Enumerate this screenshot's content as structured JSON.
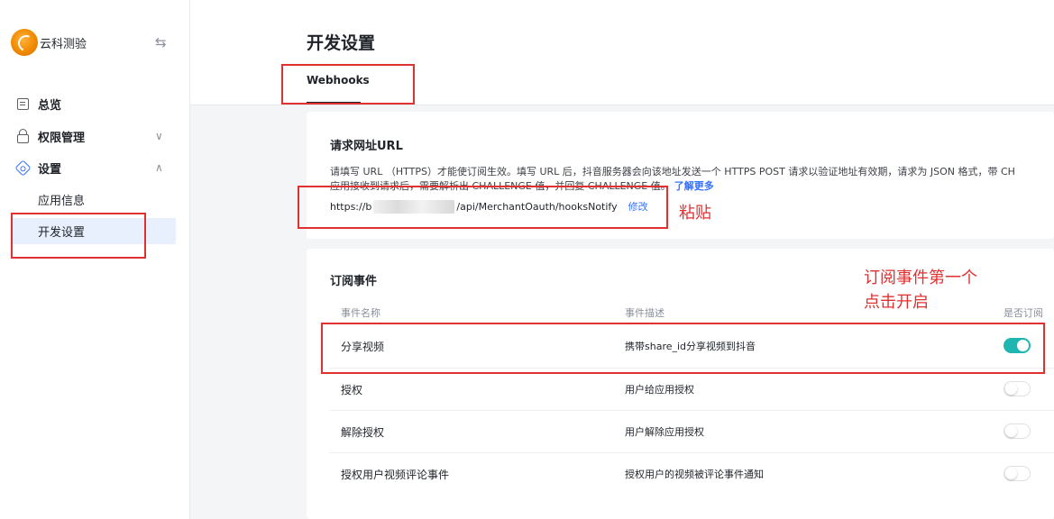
{
  "brand": {
    "name": "云科测验"
  },
  "sidebar": {
    "items": [
      {
        "label": "总览"
      },
      {
        "label": "权限管理"
      },
      {
        "label": "设置"
      }
    ],
    "sub_items": [
      {
        "label": "应用信息"
      },
      {
        "label": "开发设置"
      }
    ]
  },
  "page": {
    "title": "开发设置"
  },
  "tabs": [
    {
      "label": "Webhooks"
    }
  ],
  "request_url": {
    "title": "请求网址URL",
    "description_line1": "请填写 URL （HTTPS）才能使订阅生效。填写 URL 后，抖音服务器会向该地址发送一个 HTTPS POST 请求以验证地址有效期，请求为 JSON 格式，带 CH",
    "description_line2": "应用接收到请求后，需要解析出 CHALLENGE 值，并回复 CHALLENGE 值。",
    "learn_more": "了解更多",
    "url_prefix": "https://b",
    "url_suffix": "/api/MerchantOauth/hooksNotify",
    "edit_label": "修改"
  },
  "subscriptions": {
    "title": "订阅事件",
    "columns": {
      "name": "事件名称",
      "desc": "事件描述",
      "subscribed": "是否订阅"
    },
    "rows": [
      {
        "name": "分享视频",
        "desc": "携带share_id分享视频到抖音",
        "subscribed": true
      },
      {
        "name": "授权",
        "desc": "用户给应用授权",
        "subscribed": false
      },
      {
        "name": "解除授权",
        "desc": "用户解除应用授权",
        "subscribed": false
      },
      {
        "name": "授权用户视频评论事件",
        "desc": "授权用户的视频被评论事件通知",
        "subscribed": false
      }
    ]
  },
  "annotations": {
    "paste": "粘贴",
    "subscribe_line1": "订阅事件第一个",
    "subscribe_line2": "点击开启"
  },
  "colors": {
    "accent": "#3370ff",
    "toggle_on": "#1fb5b0",
    "annotation": "#e03131"
  }
}
